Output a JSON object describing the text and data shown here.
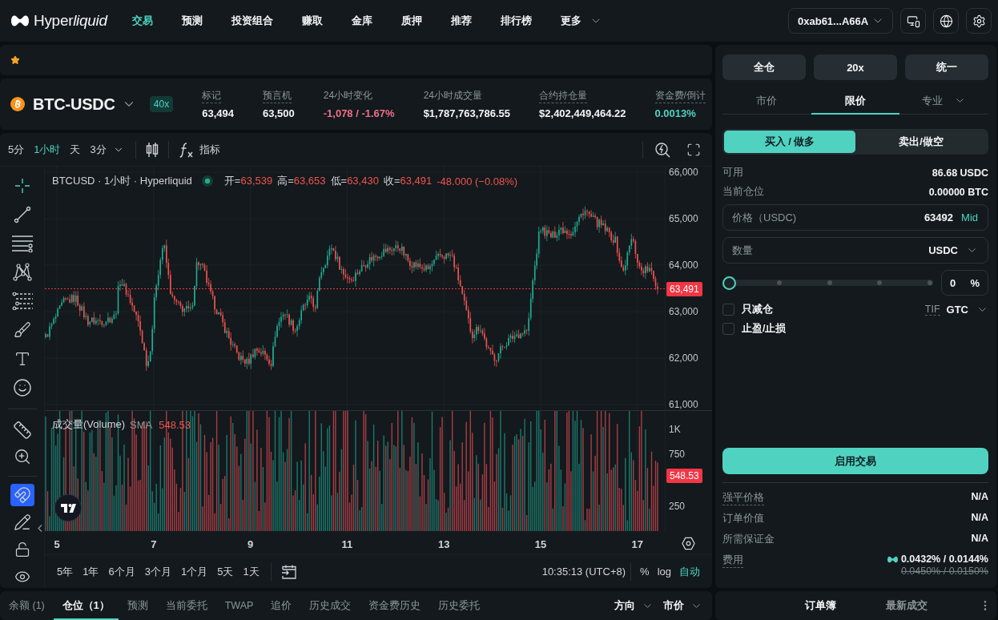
{
  "nav": {
    "brand": {
      "text": "Hyper",
      "accent": "liquid"
    },
    "items": [
      {
        "label": "交易",
        "selected": true
      },
      {
        "label": "预测",
        "selected": false
      },
      {
        "label": "投资组合",
        "selected": false
      },
      {
        "label": "赚取",
        "selected": false
      },
      {
        "label": "金库",
        "selected": false
      },
      {
        "label": "质押",
        "selected": false
      },
      {
        "label": "推荐",
        "selected": false
      },
      {
        "label": "排行榜",
        "selected": false
      },
      {
        "label": "更多",
        "selected": false,
        "dropdown": true
      }
    ],
    "wallet": "0xab61...A66A"
  },
  "ticker": {
    "symbol": "BTC-USDC",
    "leverage": "40x",
    "stats": [
      {
        "label": "标记",
        "value": "63,494",
        "dashed": true,
        "color": "#f2f5f5"
      },
      {
        "label": "预言机",
        "value": "63,500",
        "dashed": true,
        "color": "#f2f5f5"
      },
      {
        "label": "24小时变化",
        "value": "-1,078 / -1.67%",
        "dashed": false,
        "color": "#ed7088"
      },
      {
        "label": "24小时成交量",
        "value": "$1,787,763,786.55",
        "dashed": false,
        "color": "#f2f5f5"
      },
      {
        "label": "合约持仓量",
        "value": "$2,402,449,464.22",
        "dashed": true,
        "color": "#f2f5f5"
      },
      {
        "label": "资金费/倒计",
        "value": "0.0013%",
        "dashed": true,
        "color": "#50d2c1"
      }
    ]
  },
  "chart": {
    "intervals": [
      {
        "label": "5分",
        "selected": false
      },
      {
        "label": "1小时",
        "selected": true
      },
      {
        "label": "天",
        "selected": false
      },
      {
        "label": "3分",
        "selected": false,
        "dropdown": true
      }
    ],
    "indicators": "指标",
    "tool_groups": [
      [
        {
          "kind": "crosshair",
          "selected": true
        },
        {
          "kind": "trend-line",
          "selected": false
        },
        {
          "kind": "horizontal-lines",
          "selected": false
        },
        {
          "kind": "pattern",
          "selected": false
        },
        {
          "kind": "fibonacci",
          "selected": false
        },
        {
          "kind": "brush",
          "selected": false
        },
        {
          "kind": "text",
          "selected": false
        },
        {
          "kind": "emoji",
          "selected": false
        }
      ],
      [
        {
          "kind": "ruler",
          "selected": false
        },
        {
          "kind": "zoom",
          "selected": false
        }
      ],
      [
        {
          "kind": "magnet",
          "on": true
        },
        {
          "kind": "pencil-lock",
          "on": false
        },
        {
          "kind": "lock",
          "on": false
        },
        {
          "kind": "eye",
          "on": false
        }
      ]
    ],
    "legend": {
      "title": "BTCUSD · 1小时 · Hyperliquid",
      "ohlc": [
        {
          "key": "开=",
          "value": "63,539"
        },
        {
          "key": "高=",
          "value": "63,653"
        },
        {
          "key": "低=",
          "value": "63,430"
        },
        {
          "key": "收=",
          "value": "63,491"
        }
      ],
      "change": "-48.000 (−0.08%)"
    },
    "price_axis": [
      "66,000",
      "65,000",
      "64,000",
      "63,000",
      "62,000",
      "61,000"
    ],
    "last_price": "63,491",
    "volume": {
      "title": "成交量(Volume)",
      "indicator": "SMA",
      "value": "548.53",
      "axis": [
        "1K",
        "750",
        "250"
      ],
      "last": "548.53"
    },
    "time_axis": [
      "5",
      "7",
      "9",
      "11",
      "13",
      "15",
      "17"
    ],
    "ranges": [
      "5年",
      "1年",
      "6个月",
      "3个月",
      "1个月",
      "5天",
      "1天"
    ],
    "clock": "10:35:13 (UTC+8)",
    "scales": [
      {
        "label": "%",
        "selected": false
      },
      {
        "label": "log",
        "selected": false
      },
      {
        "label": "自动",
        "selected": true
      }
    ]
  },
  "positions": {
    "tabs": [
      {
        "label": "余额 (1)",
        "selected": false
      },
      {
        "label": "仓位（1）",
        "selected": true
      },
      {
        "label": "预测",
        "selected": false
      },
      {
        "label": "当前委托",
        "selected": false
      },
      {
        "label": "TWAP",
        "selected": false
      },
      {
        "label": "追价",
        "selected": false
      },
      {
        "label": "历史成交",
        "selected": false
      },
      {
        "label": "资金费历史",
        "selected": false
      },
      {
        "label": "历史委托",
        "selected": false
      }
    ],
    "filters": [
      "方向",
      "市价"
    ]
  },
  "trade": {
    "margin": [
      "全仓",
      "20x",
      "统一"
    ],
    "order_types": [
      {
        "label": "市价",
        "selected": false
      },
      {
        "label": "限价",
        "selected": true
      },
      {
        "label": "专业",
        "selected": false,
        "dropdown": true
      }
    ],
    "sides": [
      {
        "label": "买入 / 做多",
        "selected": true
      },
      {
        "label": "卖出/做空",
        "selected": false
      }
    ],
    "info": [
      {
        "label": "可用",
        "value": "86.68 USDC"
      },
      {
        "label": "当前仓位",
        "value": "0.00000 BTC"
      }
    ],
    "price_field": {
      "label": "价格（USDC)",
      "value": "63492",
      "action": "Mid"
    },
    "size_field": {
      "label": "数量",
      "unit": "USDC"
    },
    "slider": {
      "level": 0,
      "value": "0",
      "unit": "%"
    },
    "options": [
      {
        "label": "只减仓",
        "checked": false
      },
      {
        "label": "止盈/止损",
        "checked": false
      }
    ],
    "tif": {
      "label": "TIF",
      "value": "GTC"
    },
    "submit": "启用交易",
    "summary": [
      {
        "label": "强平价格",
        "value": "N/A",
        "dashed": true
      },
      {
        "label": "订单价值",
        "value": "N/A",
        "dashed": false
      },
      {
        "label": "所需保证金",
        "value": "N/A",
        "dashed": false
      },
      {
        "label": "费用",
        "value": "0.0432% / 0.0144%",
        "original": "0.0450% / 0.0150%",
        "dashed": true
      }
    ]
  },
  "book_tabs": [
    {
      "label": "订单簿",
      "selected": true
    },
    {
      "label": "最新成交",
      "selected": false
    }
  ]
}
